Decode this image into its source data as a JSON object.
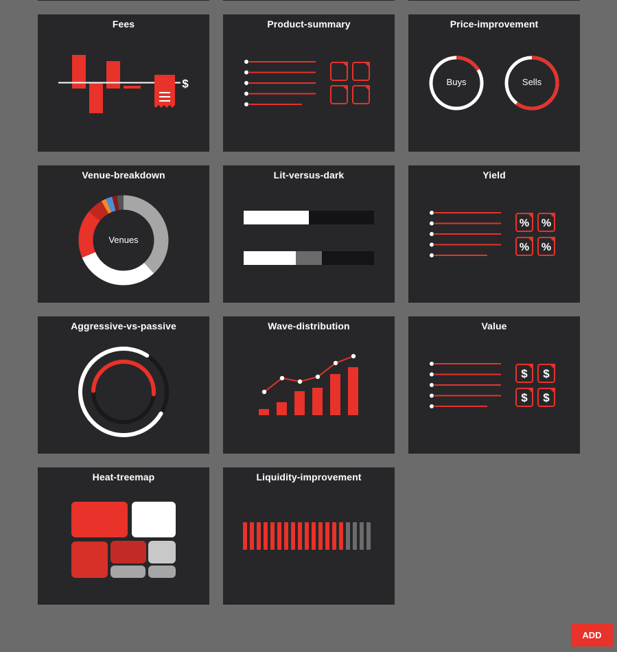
{
  "tiles": [
    {
      "id": "fees",
      "title": "Fees",
      "icons": [
        "bar-chart-icon",
        "dollar-icon",
        "receipt-icon"
      ]
    },
    {
      "id": "product-summary",
      "title": "Product-summary",
      "icons": [
        "list-icon",
        "document-grid-icon"
      ]
    },
    {
      "id": "price-improvement",
      "title": "Price-improvement",
      "buys_label": "Buys",
      "sells_label": "Sells",
      "icons": [
        "ring-gauge-icon"
      ]
    },
    {
      "id": "venue-breakdown",
      "title": "Venue-breakdown",
      "center_label": "Venues",
      "icons": [
        "donut-chart-icon"
      ]
    },
    {
      "id": "lit-versus-dark",
      "title": "Lit-versus-dark",
      "icons": [
        "progress-bar-icon"
      ]
    },
    {
      "id": "yield",
      "title": "Yield",
      "glyph": "%",
      "icons": [
        "list-icon",
        "percent-icon"
      ]
    },
    {
      "id": "aggressive-vs-passive",
      "title": "Aggressive-vs-passive",
      "icons": [
        "concentric-ring-icon"
      ]
    },
    {
      "id": "wave-distribution",
      "title": "Wave-distribution",
      "icons": [
        "bar-line-chart-icon"
      ]
    },
    {
      "id": "value",
      "title": "Value",
      "glyph": "$",
      "icons": [
        "list-icon",
        "dollar-icon"
      ]
    },
    {
      "id": "heat-treemap",
      "title": "Heat-treemap",
      "icons": [
        "treemap-icon"
      ]
    },
    {
      "id": "liquidity-improvement",
      "title": "Liquidity-improvement",
      "icons": [
        "striped-bar-icon"
      ]
    }
  ],
  "fees_dollar": "$",
  "add_button_label": "ADD",
  "colors": {
    "background": "#6b6b6b",
    "tile": "#27272a",
    "accent": "#e8322a",
    "light": "#ffffff",
    "muted": "#a6a6a6",
    "dark_track": "#141416"
  }
}
